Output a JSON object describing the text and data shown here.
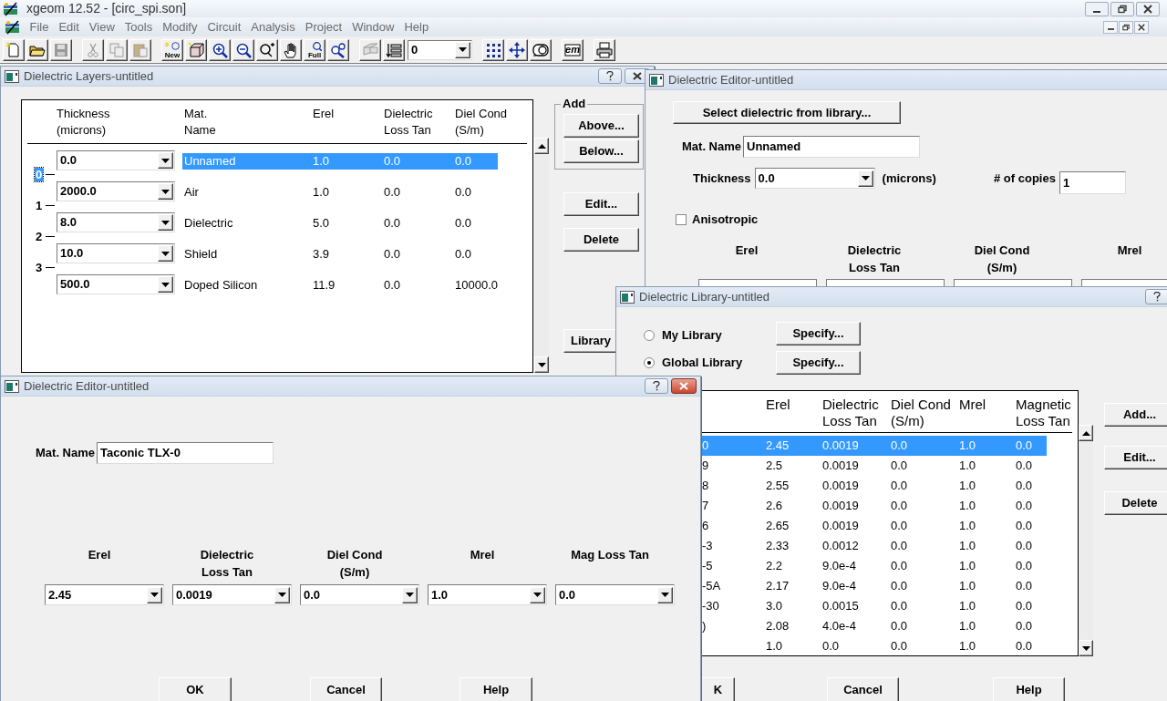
{
  "app": {
    "title": "xgeom 12.52 - [circ_spi.son]"
  },
  "menu": [
    "File",
    "Edit",
    "View",
    "Tools",
    "Modify",
    "Circuit",
    "Analysis",
    "Project",
    "Window",
    "Help"
  ],
  "toolbar": {
    "groups": [
      [
        {
          "kind": "new-file",
          "disabled": false
        },
        {
          "kind": "open",
          "disabled": false
        },
        {
          "kind": "save",
          "disabled": true
        }
      ],
      [
        {
          "kind": "cut",
          "disabled": true
        },
        {
          "kind": "copy",
          "disabled": true
        },
        {
          "kind": "paste",
          "disabled": true
        }
      ],
      [
        {
          "kind": "new-object",
          "label": "New",
          "disabled": false
        },
        {
          "kind": "box3d",
          "disabled": false
        },
        {
          "kind": "zoom-in",
          "disabled": false
        },
        {
          "kind": "zoom-out",
          "disabled": false
        },
        {
          "kind": "zoom-box",
          "disabled": false
        },
        {
          "kind": "hand",
          "disabled": false
        },
        {
          "kind": "full",
          "label": "Full",
          "disabled": false
        },
        {
          "kind": "zoom-mix",
          "disabled": false
        }
      ],
      [
        {
          "kind": "hatch",
          "disabled": true
        },
        {
          "kind": "layers",
          "disabled": false
        },
        {
          "kind": "combo",
          "value": "0"
        }
      ],
      [
        {
          "kind": "grid",
          "disabled": false
        },
        {
          "kind": "move",
          "disabled": false
        },
        {
          "kind": "measure",
          "disabled": false
        }
      ],
      [
        {
          "kind": "em",
          "label": "em",
          "disabled": false
        }
      ],
      [
        {
          "kind": "print",
          "disabled": false
        }
      ]
    ]
  },
  "layers_window": {
    "title": "Dielectric Layers-untitled",
    "columns": [
      "Thickness\n(microns)",
      "Mat.\nName",
      "Erel",
      "Dielectric\nLoss Tan",
      "Diel Cond\n(S/m)"
    ],
    "rows": [
      {
        "thickness": "0.0",
        "name": "Unnamed",
        "erel": "1.0",
        "loss_tan": "0.0",
        "cond": "0.0",
        "selected": true
      },
      {
        "thickness": "2000.0",
        "name": "Air",
        "erel": "1.0",
        "loss_tan": "0.0",
        "cond": "0.0",
        "selected": false
      },
      {
        "thickness": "8.0",
        "name": "Dielectric",
        "erel": "5.0",
        "loss_tan": "0.0",
        "cond": "0.0",
        "selected": false
      },
      {
        "thickness": "10.0",
        "name": "Shield",
        "erel": "3.9",
        "loss_tan": "0.0",
        "cond": "0.0",
        "selected": false
      },
      {
        "thickness": "500.0",
        "name": "Doped Silicon",
        "erel": "11.9",
        "loss_tan": "0.0",
        "cond": "10000.0",
        "selected": false
      }
    ],
    "levels": [
      {
        "label": "0",
        "selected": true
      },
      {
        "label": "1",
        "selected": false
      },
      {
        "label": "2",
        "selected": false
      },
      {
        "label": "3",
        "selected": false
      }
    ],
    "add_group": {
      "label": "Add",
      "buttons": [
        "Above...",
        "Below..."
      ]
    },
    "buttons": [
      "Edit...",
      "Delete",
      "Library"
    ]
  },
  "editor_top": {
    "title": "Dielectric Editor-untitled",
    "select_button": "Select dielectric from library...",
    "mat_name": {
      "label": "Mat. Name",
      "value": "Unnamed"
    },
    "thickness": {
      "label": "Thickness",
      "value": "0.0",
      "unit": "(microns)"
    },
    "copies": {
      "label": "# of copies",
      "value": "1"
    },
    "anisotropic": {
      "label": "Anisotropic",
      "checked": false
    },
    "columns": [
      "Erel",
      "Dielectric\nLoss Tan",
      "Diel Cond\n(S/m)",
      "Mrel"
    ]
  },
  "library": {
    "title": "Dielectric Library-untitled",
    "sources": [
      {
        "label": "My Library",
        "selected": false,
        "button": "Specify..."
      },
      {
        "label": "Global Library",
        "selected": true,
        "button": "Specify..."
      }
    ],
    "columns": [
      "Erel",
      "Dielectric\nLoss Tan",
      "Diel Cond\n(S/m)",
      "Mrel",
      "Magnetic\nLoss Tan"
    ],
    "rows": [
      {
        "name": "0",
        "erel": "2.45",
        "loss_tan": "0.0019",
        "cond": "0.0",
        "mrel": "1.0",
        "mag_loss": "0.0",
        "selected": true
      },
      {
        "name": "9",
        "erel": "2.5",
        "loss_tan": "0.0019",
        "cond": "0.0",
        "mrel": "1.0",
        "mag_loss": "0.0",
        "selected": false
      },
      {
        "name": "8",
        "erel": "2.55",
        "loss_tan": "0.0019",
        "cond": "0.0",
        "mrel": "1.0",
        "mag_loss": "0.0",
        "selected": false
      },
      {
        "name": "7",
        "erel": "2.6",
        "loss_tan": "0.0019",
        "cond": "0.0",
        "mrel": "1.0",
        "mag_loss": "0.0",
        "selected": false
      },
      {
        "name": "6",
        "erel": "2.65",
        "loss_tan": "0.0019",
        "cond": "0.0",
        "mrel": "1.0",
        "mag_loss": "0.0",
        "selected": false
      },
      {
        "name": "-3",
        "erel": "2.33",
        "loss_tan": "0.0012",
        "cond": "0.0",
        "mrel": "1.0",
        "mag_loss": "0.0",
        "selected": false
      },
      {
        "name": "-5",
        "erel": "2.2",
        "loss_tan": "9.0e-4",
        "cond": "0.0",
        "mrel": "1.0",
        "mag_loss": "0.0",
        "selected": false
      },
      {
        "name": "-5A",
        "erel": "2.17",
        "loss_tan": "9.0e-4",
        "cond": "0.0",
        "mrel": "1.0",
        "mag_loss": "0.0",
        "selected": false
      },
      {
        "name": "-30",
        "erel": "3.0",
        "loss_tan": "0.0015",
        "cond": "0.0",
        "mrel": "1.0",
        "mag_loss": "0.0",
        "selected": false
      },
      {
        "name": ")",
        "erel": "2.08",
        "loss_tan": "4.0e-4",
        "cond": "0.0",
        "mrel": "1.0",
        "mag_loss": "0.0",
        "selected": false
      },
      {
        "erel": "1.0",
        "loss_tan": "0.0",
        "cond": "0.0",
        "mrel": "1.0",
        "mag_loss": "0.0",
        "selected": false
      }
    ],
    "side_buttons": [
      "Add...",
      "Edit...",
      "Delete"
    ],
    "bottom_buttons": [
      "K",
      "Cancel",
      "Help"
    ]
  },
  "editor_bottom": {
    "title": "Dielectric Editor-untitled",
    "mat_name": {
      "label": "Mat. Name",
      "value": "Taconic TLX-0"
    },
    "fields": [
      {
        "label": "Erel",
        "value": "2.45"
      },
      {
        "label": "Dielectric\nLoss Tan",
        "value": "0.0019"
      },
      {
        "label": "Diel Cond\n(S/m)",
        "value": "0.0"
      },
      {
        "label": "Mrel",
        "value": "1.0"
      },
      {
        "label": "Mag Loss Tan",
        "value": "0.0"
      }
    ],
    "buttons": [
      "OK",
      "Cancel",
      "Help"
    ]
  }
}
